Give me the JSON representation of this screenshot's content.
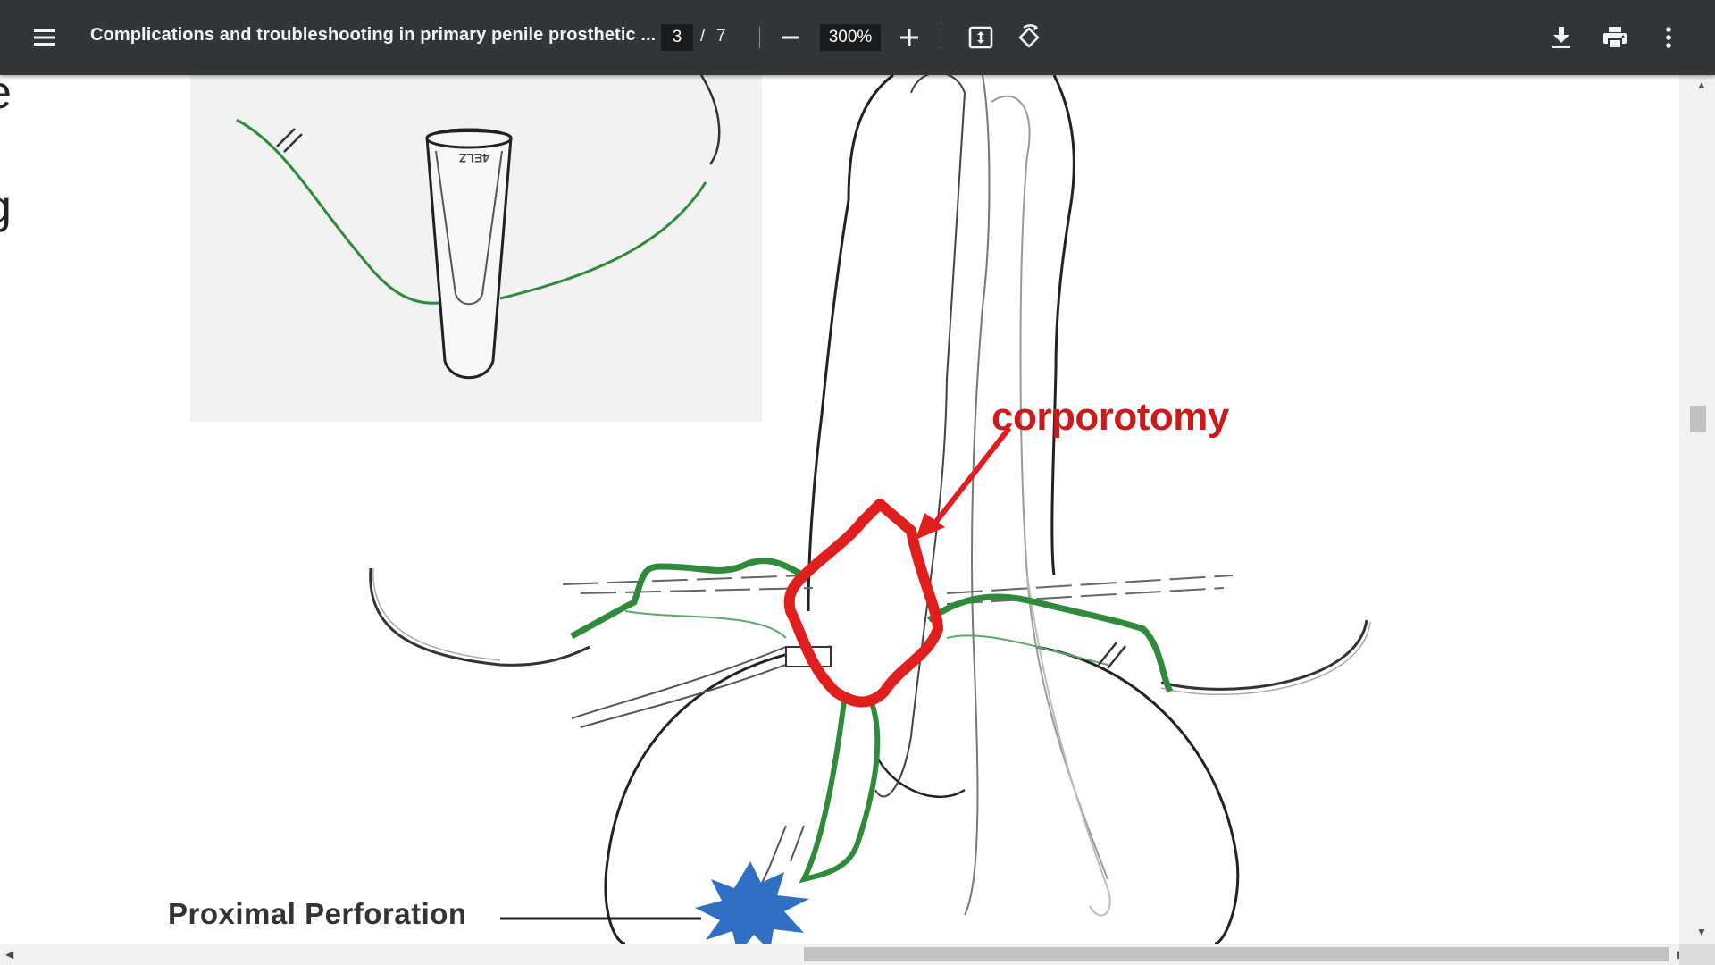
{
  "toolbar": {
    "menu_icon": "hamburger-menu-icon",
    "title": "Complications and troubleshooting in primary penile prosthetic ...",
    "page_current": "3",
    "page_separator": "/",
    "page_total": "7",
    "zoom_out_icon": "minus-icon",
    "zoom": "300%",
    "zoom_in_icon": "plus-icon",
    "fit_icon": "fit-to-page-icon",
    "rotate_icon": "rotate-icon",
    "download_icon": "download-icon",
    "print_icon": "print-icon",
    "more_icon": "more-vert-icon"
  },
  "document": {
    "side_text_lines": [
      "e",
      "/",
      "g"
    ],
    "figure": {
      "label_corporotomy": "corporotomy",
      "label_proximal": "Proximal Perforation",
      "inset_tube_text": "4ELZ",
      "colors": {
        "suture": "#2f8a3a",
        "corporotomy": "#e01e1e",
        "perforation": "#2f6fc4"
      }
    }
  },
  "scrollbars": {
    "vertical_position": 0.35,
    "horizontal_position": 0.48
  }
}
